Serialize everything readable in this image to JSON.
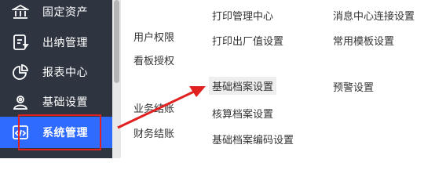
{
  "sidebar": {
    "items": [
      {
        "label": "固定资产",
        "icon": "bank-icon"
      },
      {
        "label": "出纳管理",
        "icon": "ledger-icon"
      },
      {
        "label": "报表中心",
        "icon": "pie-chart-icon"
      },
      {
        "label": "基础设置",
        "icon": "settings-person-icon"
      },
      {
        "label": "系统管理",
        "icon": "code-window-icon",
        "active": true
      }
    ]
  },
  "menu": {
    "col1": [
      "用户权限",
      "看板授权",
      "业务结账",
      "财务结账"
    ],
    "col2": [
      "打印管理中心",
      "打印出厂值设置",
      "基础档案设置",
      "核算档案设置",
      "基础档案编码设置"
    ],
    "col3": [
      "消息中心连接设置",
      "常用模板设置",
      "预警设置"
    ],
    "highlighted": "基础档案设置"
  },
  "colors": {
    "sidebar_bg": "#2f3540",
    "active_bg": "#2f6bff",
    "annotation": "#e12020"
  }
}
